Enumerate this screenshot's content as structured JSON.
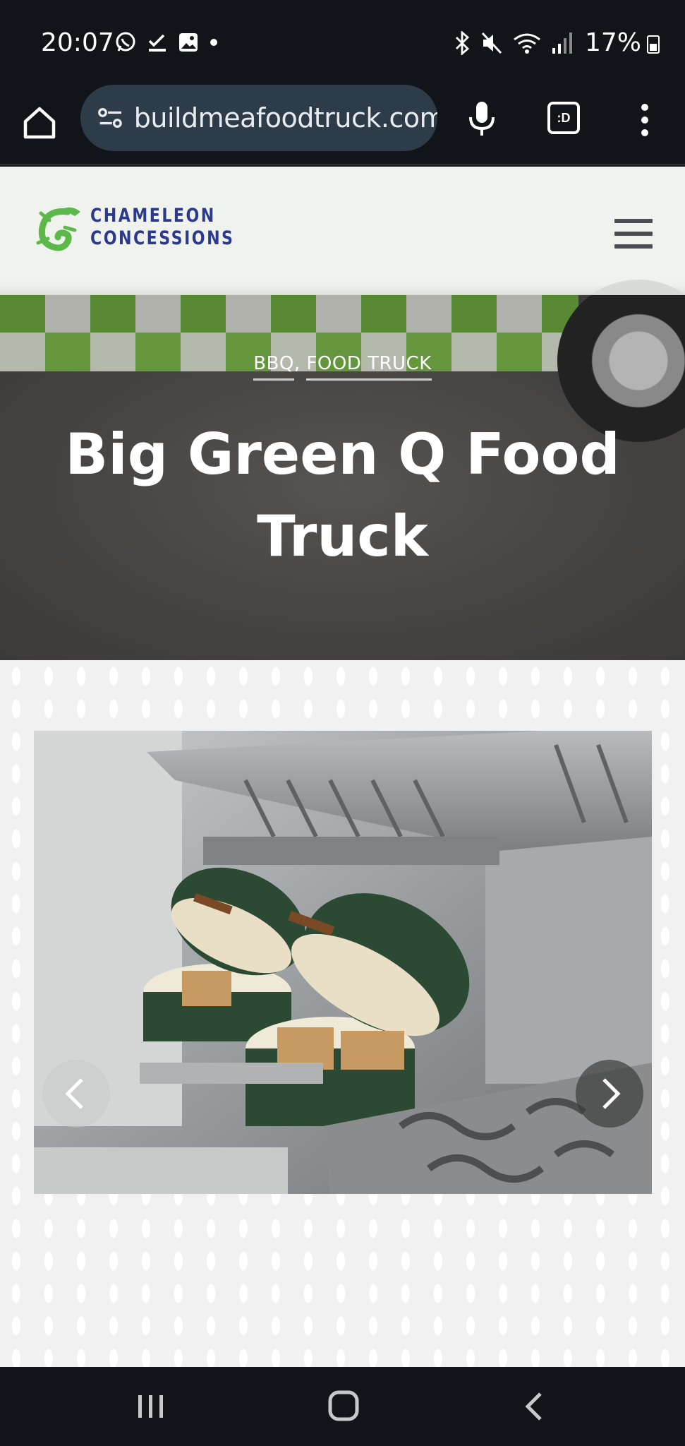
{
  "status_bar": {
    "time": "20:07",
    "battery": "17%",
    "left_icons": [
      "whatsapp-icon",
      "checkmark-download-icon",
      "gallery-icon",
      "dot-icon"
    ],
    "right_icons": [
      "bluetooth-icon",
      "mute-icon",
      "wifi-icon",
      "signal-icon",
      "battery-icon"
    ]
  },
  "browser": {
    "url": "buildmeafoodtruck.com/",
    "tab_label": ":D"
  },
  "site": {
    "logo": {
      "line1": "CHAMELEON",
      "line2": "CONCESSIONS"
    },
    "categories": [
      "BBQ",
      "FOOD TRUCK"
    ],
    "category_separator": ", ",
    "title": "Big Green Q Food Truck"
  },
  "slider": {
    "image_description": "kitchen-grills",
    "prev_label": "",
    "next_label": ""
  },
  "colors": {
    "logo_blue": "#2b3a8c",
    "logo_green": "#5cb848",
    "egg_green": "#2c4a33"
  }
}
